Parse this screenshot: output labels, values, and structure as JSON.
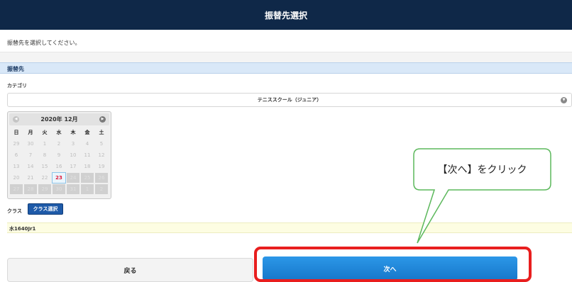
{
  "header": {
    "title": "振替先選択"
  },
  "instruction": "振替先を選択してください。",
  "section": {
    "title": "振替先"
  },
  "category": {
    "label": "カテゴリ",
    "selected": "テニススクール（ジュニア）"
  },
  "calendar": {
    "month_label": "2020年 12月",
    "weekdays": [
      "日",
      "月",
      "火",
      "水",
      "木",
      "金",
      "土"
    ],
    "weeks": [
      [
        "29",
        "30",
        "1",
        "2",
        "3",
        "4",
        "5"
      ],
      [
        "6",
        "7",
        "8",
        "9",
        "10",
        "11",
        "12"
      ],
      [
        "13",
        "14",
        "15",
        "16",
        "17",
        "18",
        "19"
      ],
      [
        "20",
        "21",
        "22",
        "23",
        "24",
        "25",
        "26"
      ],
      [
        "27",
        "28",
        "29",
        "30",
        "31",
        "1",
        "2"
      ]
    ],
    "today": "23"
  },
  "class_section": {
    "label": "クラス",
    "button_label": "クラス選択",
    "selected": "水1640Jr1"
  },
  "footer": {
    "back_label": "戻る",
    "next_label": "次へ"
  },
  "callout": {
    "text": "【次へ】をクリック"
  },
  "colors": {
    "header_bg": "#0f2848",
    "accent_blue": "#1677c9",
    "highlight_red": "#e81e1e",
    "today_red": "#e0193a"
  }
}
